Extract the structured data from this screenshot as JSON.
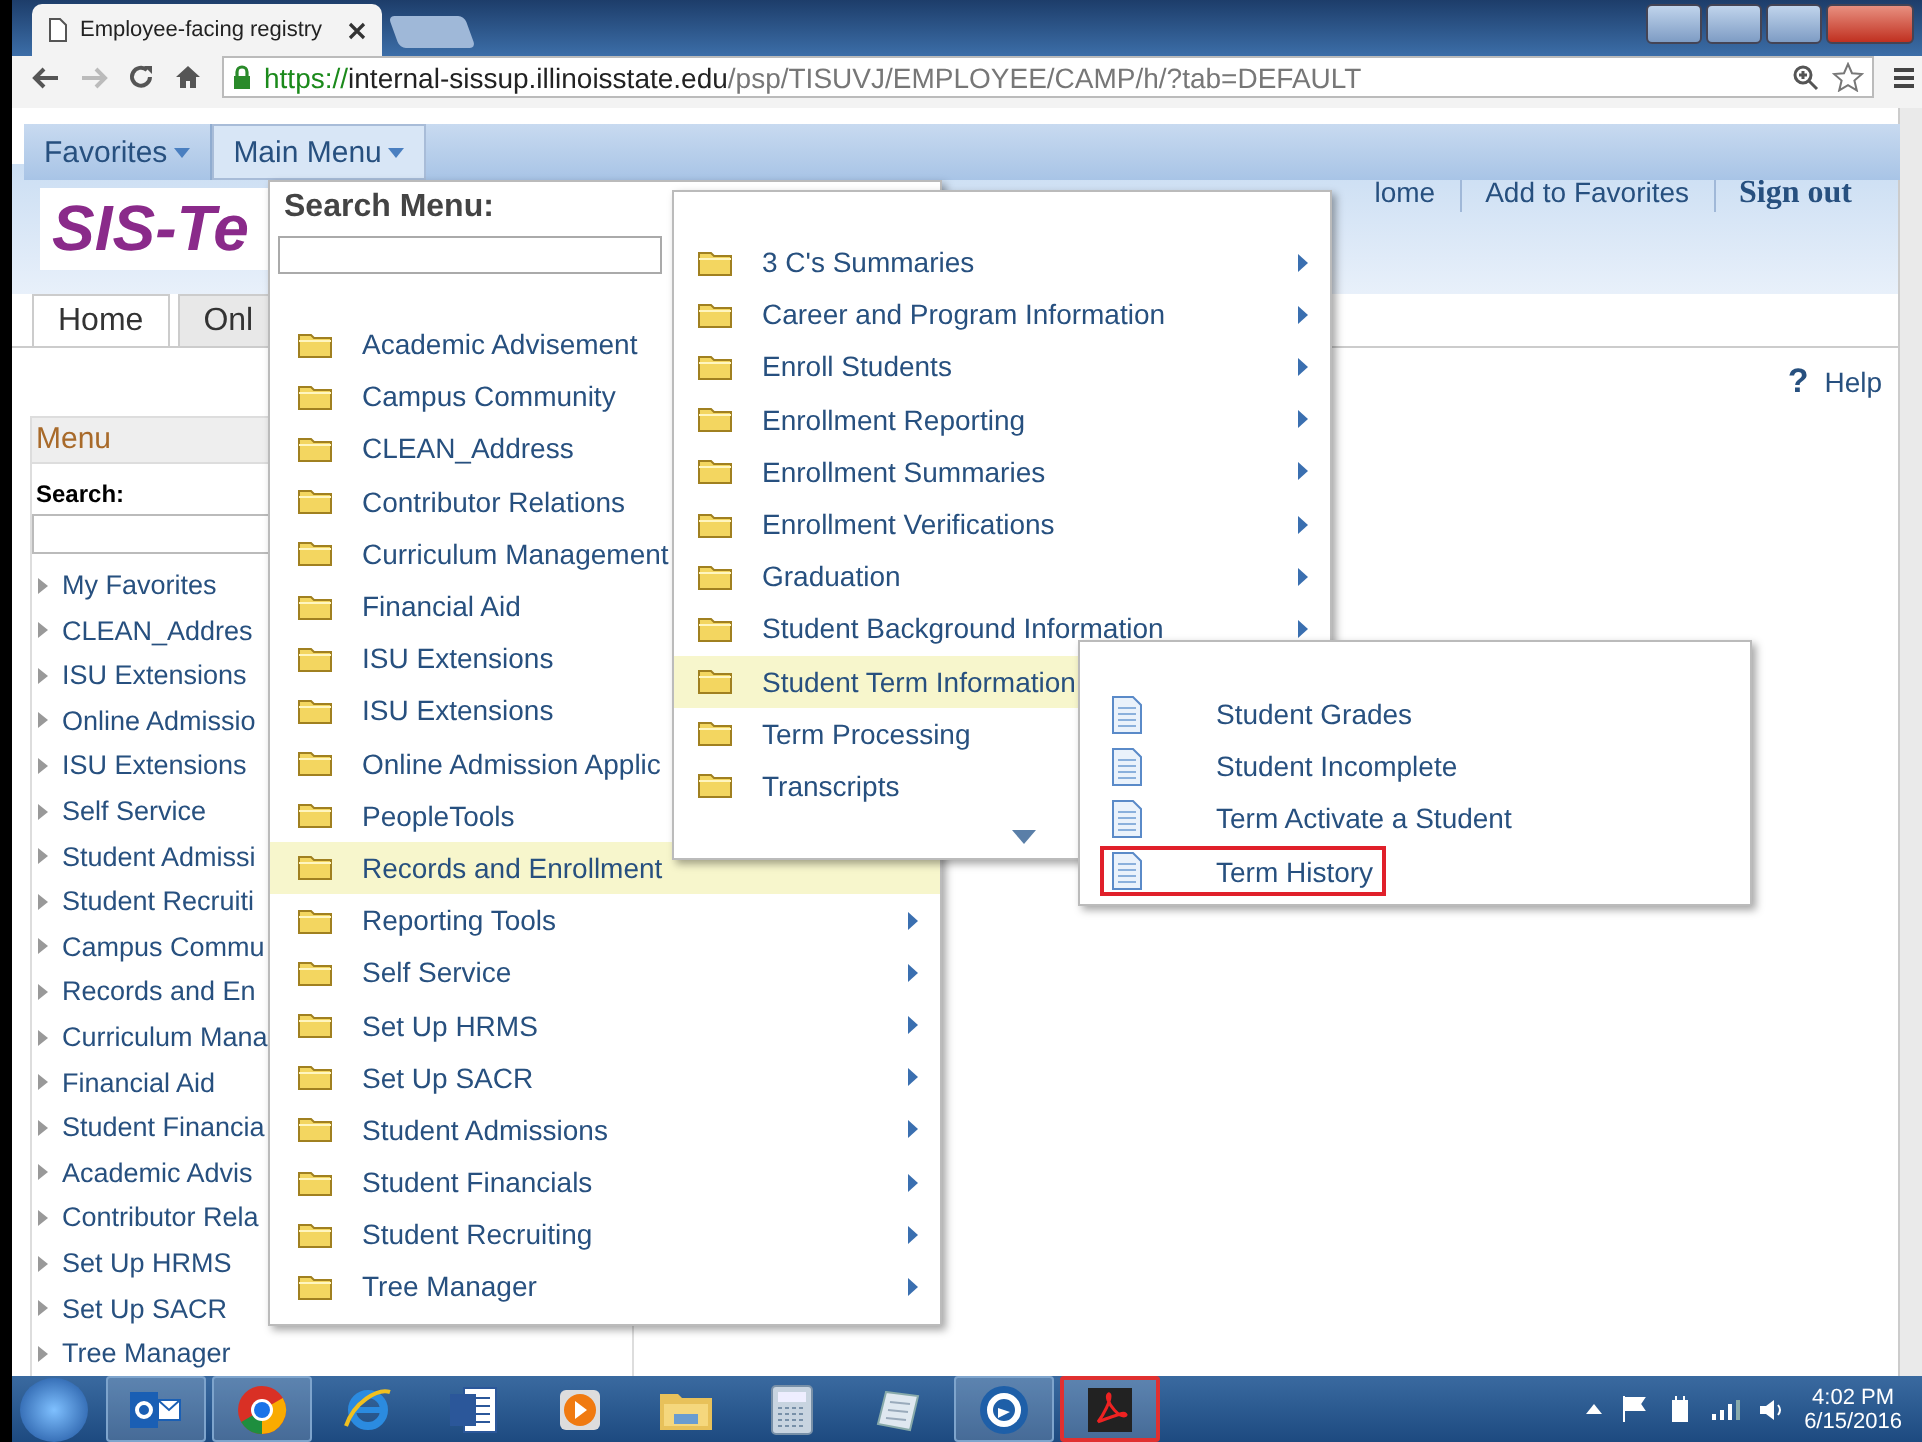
{
  "browser": {
    "tab_title": "Employee-facing registry",
    "url": {
      "scheme": "https://",
      "host": "internal-sissup.illinoisstate.edu",
      "path": "/psp/TISUVJ/EMPLOYEE/CAMP/h/?tab=DEFAULT"
    }
  },
  "nav": [
    {
      "label": "Favorites",
      "selected": false
    },
    {
      "label": "Main Menu",
      "selected": true
    }
  ],
  "logo": "SIS-Te",
  "header_links": [
    {
      "label": "lome",
      "emphasis": false
    },
    {
      "label": "Add to Favorites",
      "emphasis": false
    },
    {
      "label": "Sign out",
      "emphasis": true
    }
  ],
  "page_tabs": [
    {
      "label": "Home",
      "selected": true
    },
    {
      "label": "Onl",
      "selected": false
    }
  ],
  "help": {
    "mark": "?",
    "label": "Help"
  },
  "sidebar": {
    "title": "Menu",
    "search_label": "Search:",
    "items": [
      "My Favorites",
      "CLEAN_Addres",
      "ISU Extensions",
      "Online Admissio",
      "ISU Extensions",
      "Self Service",
      "Student Admissi",
      "Student Recruiti",
      "Campus Commu",
      "Records and En",
      "Curriculum Mana",
      "Financial Aid",
      "Student Financia",
      "Academic Advis",
      "Contributor Rela",
      "Set Up HRMS",
      "Set Up SACR",
      "Tree Manager"
    ]
  },
  "main_menu": {
    "search_label": "Search Menu:",
    "items": [
      {
        "label": "Academic Advisement",
        "selected": false
      },
      {
        "label": "Campus Community",
        "selected": false
      },
      {
        "label": "CLEAN_Address",
        "selected": false
      },
      {
        "label": "Contributor Relations",
        "selected": false
      },
      {
        "label": "Curriculum Management",
        "selected": false
      },
      {
        "label": "Financial Aid",
        "selected": false
      },
      {
        "label": "ISU Extensions",
        "selected": false
      },
      {
        "label": "ISU Extensions",
        "selected": false
      },
      {
        "label": "Online Admission Applic",
        "selected": false
      },
      {
        "label": "PeopleTools",
        "selected": false
      },
      {
        "label": "Records and Enrollment",
        "selected": true
      },
      {
        "label": "Reporting Tools",
        "selected": false,
        "arrow": true
      },
      {
        "label": "Self Service",
        "selected": false,
        "arrow": true
      },
      {
        "label": "Set Up HRMS",
        "selected": false,
        "arrow": true
      },
      {
        "label": "Set Up SACR",
        "selected": false,
        "arrow": true
      },
      {
        "label": "Student Admissions",
        "selected": false,
        "arrow": true
      },
      {
        "label": "Student Financials",
        "selected": false,
        "arrow": true
      },
      {
        "label": "Student Recruiting",
        "selected": false,
        "arrow": true
      },
      {
        "label": "Tree Manager",
        "selected": false,
        "arrow": true
      }
    ]
  },
  "submenu": {
    "more_below": true,
    "items": [
      {
        "label": "3 C's Summaries",
        "selected": false,
        "arrow": true
      },
      {
        "label": "Career and Program Information",
        "selected": false,
        "arrow": true
      },
      {
        "label": "Enroll Students",
        "selected": false,
        "arrow": true
      },
      {
        "label": "Enrollment Reporting",
        "selected": false,
        "arrow": true
      },
      {
        "label": "Enrollment Summaries",
        "selected": false,
        "arrow": true
      },
      {
        "label": "Enrollment Verifications",
        "selected": false,
        "arrow": true
      },
      {
        "label": "Graduation",
        "selected": false,
        "arrow": true
      },
      {
        "label": "Student Background Information",
        "selected": false,
        "arrow": true
      },
      {
        "label": "Student Term Information",
        "selected": true
      },
      {
        "label": "Term Processing",
        "selected": false
      },
      {
        "label": "Transcripts",
        "selected": false
      }
    ]
  },
  "submenu_2": {
    "items": [
      {
        "label": "Student Grades",
        "highlighted": false
      },
      {
        "label": "Student Incomplete",
        "highlighted": false
      },
      {
        "label": "Term Activate a Student",
        "highlighted": false
      },
      {
        "label": "Term History",
        "highlighted": true
      }
    ]
  },
  "taskbar": {
    "apps": [
      {
        "kind": "mail",
        "running": true,
        "selected": false
      },
      {
        "kind": "chrome",
        "running": true,
        "selected": false
      },
      {
        "kind": "ie",
        "running": false,
        "selected": false
      },
      {
        "kind": "word",
        "running": false,
        "selected": false
      },
      {
        "kind": "media",
        "running": false,
        "selected": false
      },
      {
        "kind": "folder",
        "running": false,
        "selected": false
      },
      {
        "kind": "calculator",
        "running": false,
        "selected": false
      },
      {
        "kind": "notepad",
        "running": false,
        "selected": false
      },
      {
        "kind": "circle",
        "running": true,
        "selected": false
      },
      {
        "kind": "pdf",
        "running": true,
        "selected": true
      }
    ],
    "time": "4:02 PM",
    "date": "6/15/2016"
  }
}
